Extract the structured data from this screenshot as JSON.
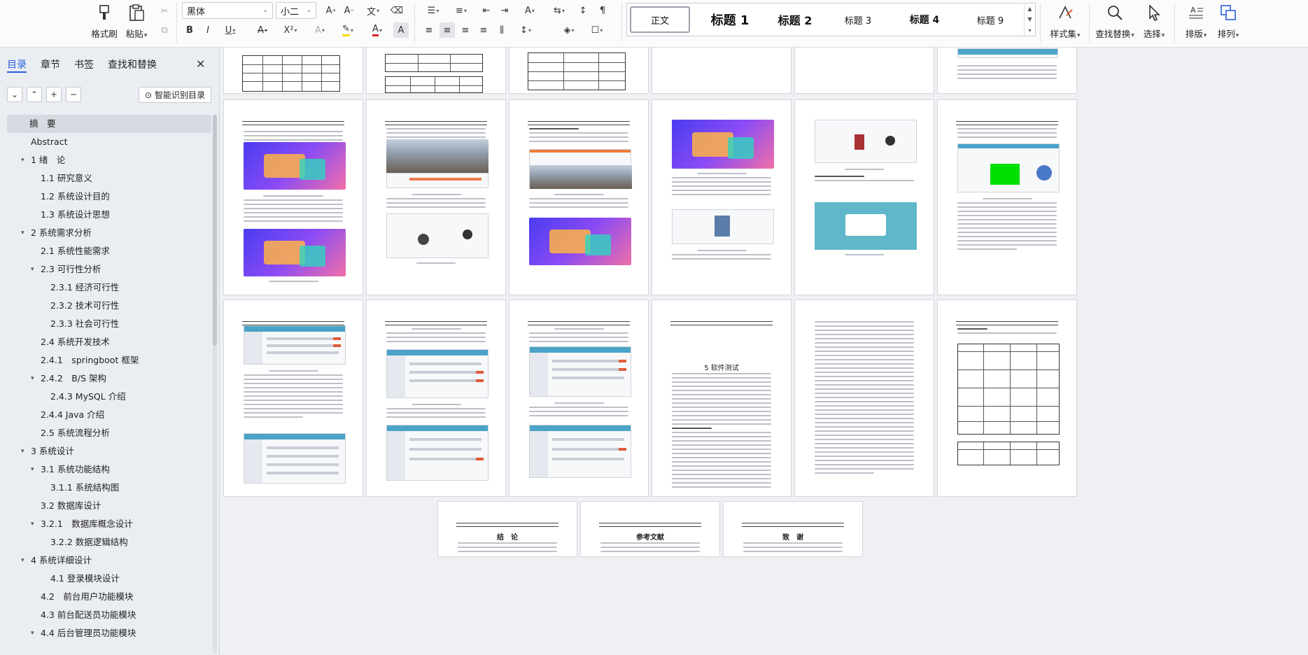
{
  "ribbon": {
    "format_painter": "格式刷",
    "paste": "粘贴",
    "font_name": "黑体",
    "font_size": "小二",
    "styles": [
      "正文",
      "标题 1",
      "标题 2",
      "标题 3",
      "标题 4",
      "标题 9"
    ],
    "style_set": "样式集",
    "find_replace": "查找替换",
    "select": "选择",
    "layout": "排版",
    "arrange": "排列"
  },
  "nav": {
    "tabs": [
      "目录",
      "章节",
      "书签",
      "查找和替换"
    ],
    "smart_toc": "智能识别目录",
    "items": [
      {
        "label": "摘　要",
        "level": 0,
        "caret": false,
        "selected": true
      },
      {
        "label": "Abstract",
        "level": 1,
        "caret": false
      },
      {
        "label": "1 绪　论",
        "level": 1,
        "caret": true
      },
      {
        "label": "1.1 研究意义",
        "level": 2,
        "caret": false
      },
      {
        "label": "1.2 系统设计目的",
        "level": 2,
        "caret": false
      },
      {
        "label": "1.3 系统设计思想",
        "level": 2,
        "caret": false
      },
      {
        "label": "2 系统需求分析",
        "level": 1,
        "caret": true
      },
      {
        "label": "2.1 系统性能需求",
        "level": 2,
        "caret": false
      },
      {
        "label": "2.3 可行性分析",
        "level": 2,
        "caret": true
      },
      {
        "label": "2.3.1 经济可行性",
        "level": 3,
        "caret": false
      },
      {
        "label": "2.3.2 技术可行性",
        "level": 3,
        "caret": false
      },
      {
        "label": "2.3.3 社会可行性",
        "level": 3,
        "caret": false
      },
      {
        "label": "2.4 系统开发技术",
        "level": 2,
        "caret": false
      },
      {
        "label": "2.4.1　springboot 框架",
        "level": 2,
        "caret": false
      },
      {
        "label": "2.4.2　B/S 架构",
        "level": 2,
        "caret": true
      },
      {
        "label": "2.4.3 MySQL 介绍",
        "level": 3,
        "caret": false
      },
      {
        "label": "2.4.4 Java 介绍",
        "level": 2,
        "caret": false
      },
      {
        "label": "2.5 系统流程分析",
        "level": 2,
        "caret": false
      },
      {
        "label": "3 系统设计",
        "level": 1,
        "caret": true
      },
      {
        "label": "3.1 系统功能结构",
        "level": 2,
        "caret": true
      },
      {
        "label": "3.1.1 系统结构图",
        "level": 3,
        "caret": false
      },
      {
        "label": "3.2 数据库设计",
        "level": 2,
        "caret": false
      },
      {
        "label": "3.2.1　数据库概念设计",
        "level": 2,
        "caret": true
      },
      {
        "label": "3.2.2 数据逻辑结构",
        "level": 3,
        "caret": false
      },
      {
        "label": "4 系统详细设计",
        "level": 1,
        "caret": true
      },
      {
        "label": "4.1 登录模块设计",
        "level": 3,
        "caret": false
      },
      {
        "label": "4.2　前台用户功能模块",
        "level": 2,
        "caret": false
      },
      {
        "label": "4.3 前台配送员功能模块",
        "level": 2,
        "caret": false
      },
      {
        "label": "4.4 后台管理员功能模块",
        "level": 2,
        "caret": true
      }
    ]
  },
  "doc": {
    "chapter5_title": "5 软件测试",
    "conclusion_title": "结　论",
    "references_title": "参考文献",
    "thanks_title": "致　谢"
  }
}
